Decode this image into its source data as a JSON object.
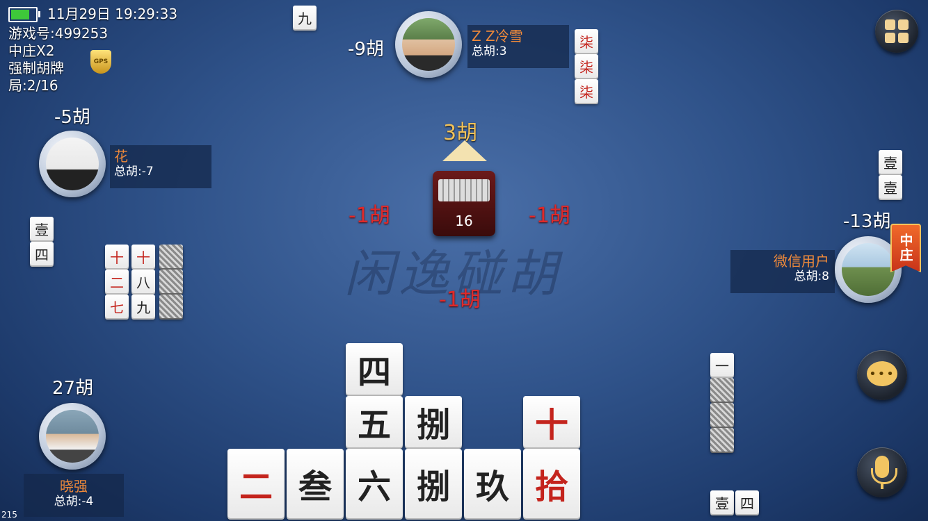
{
  "status": {
    "datetime": "11月29日 19:29:33",
    "game_id": "游戏号:499253",
    "rule1": "中庄X2",
    "rule2": "强制胡牌",
    "round": "局:2/16",
    "gps": "GPS",
    "corner_number": "215",
    "battery_color": "#3ec83a"
  },
  "watermark": "闲逸碰胡",
  "center": {
    "current_hu": "3胡",
    "remaining": "16",
    "score_left": "-1胡",
    "score_right": "-1胡",
    "score_bottom": "-1胡"
  },
  "players": {
    "top": {
      "score": "-9胡",
      "name": "Z Z冷雪",
      "total": "总胡:3",
      "melds": [
        "柒",
        "柒",
        "柒"
      ],
      "discard": "九"
    },
    "left": {
      "score": "-5胡",
      "name": "花",
      "total": "总胡:-7",
      "discards": [
        "壹",
        "四"
      ],
      "melds": [
        [
          "十",
          "二",
          "七"
        ],
        [
          "十",
          "八",
          "九"
        ]
      ]
    },
    "right": {
      "score": "-13胡",
      "name": "微信用户",
      "total": "总胡:8",
      "dealer": "中庄",
      "discards": [
        "壹",
        "壹"
      ],
      "hand_top": "一",
      "bottom_tiles": [
        "壹",
        "四"
      ]
    },
    "self": {
      "score": "27胡",
      "name": "晓强",
      "total": "总胡:-4"
    }
  },
  "hand": {
    "row_top": [
      "四"
    ],
    "row_mid": [
      "五",
      "捌",
      "十"
    ],
    "row_bottom": [
      "二",
      "叁",
      "六",
      "捌",
      "玖",
      "拾"
    ]
  },
  "buttons": {
    "menu": "menu-grid-icon",
    "chat": "chat-bubble-icon",
    "voice": "microphone-icon"
  }
}
